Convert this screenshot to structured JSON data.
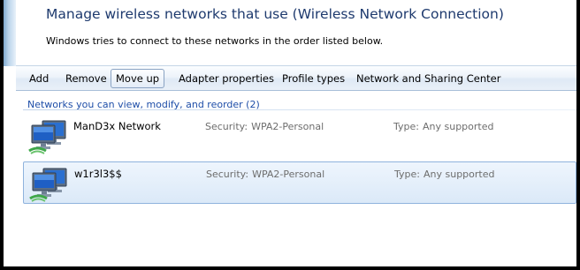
{
  "header": {
    "title": "Manage wireless networks that use (Wireless Network Connection)",
    "description": "Windows tries to connect to these networks in the order listed below."
  },
  "toolbar": {
    "add_label": "Add",
    "remove_label": "Remove",
    "move_up_label": "Move up",
    "adapter_properties_label": "Adapter properties",
    "profile_types_label": "Profile types",
    "network_sharing_center_label": "Network and Sharing Center"
  },
  "networks": {
    "group_header": "Networks you can view, modify, and reorder (2)",
    "items": [
      {
        "name": "ManD3x Network",
        "security_label": "Security:",
        "security_value": "WPA2-Personal",
        "type_label": "Type:",
        "type_value": "Any supported",
        "selected": false,
        "icon": "wireless-network-monitor-icon"
      },
      {
        "name": "w1r3l3$$",
        "security_label": "Security:",
        "security_value": "WPA2-Personal",
        "type_label": "Type:",
        "type_value": "Any supported",
        "selected": true,
        "icon": "wireless-network-monitor-icon"
      }
    ]
  },
  "colors": {
    "heading": "#1e3a6e",
    "group_header": "#1e4ea8",
    "selection_border": "#8fb3dd",
    "selection_fill": "#dbe9f8"
  }
}
